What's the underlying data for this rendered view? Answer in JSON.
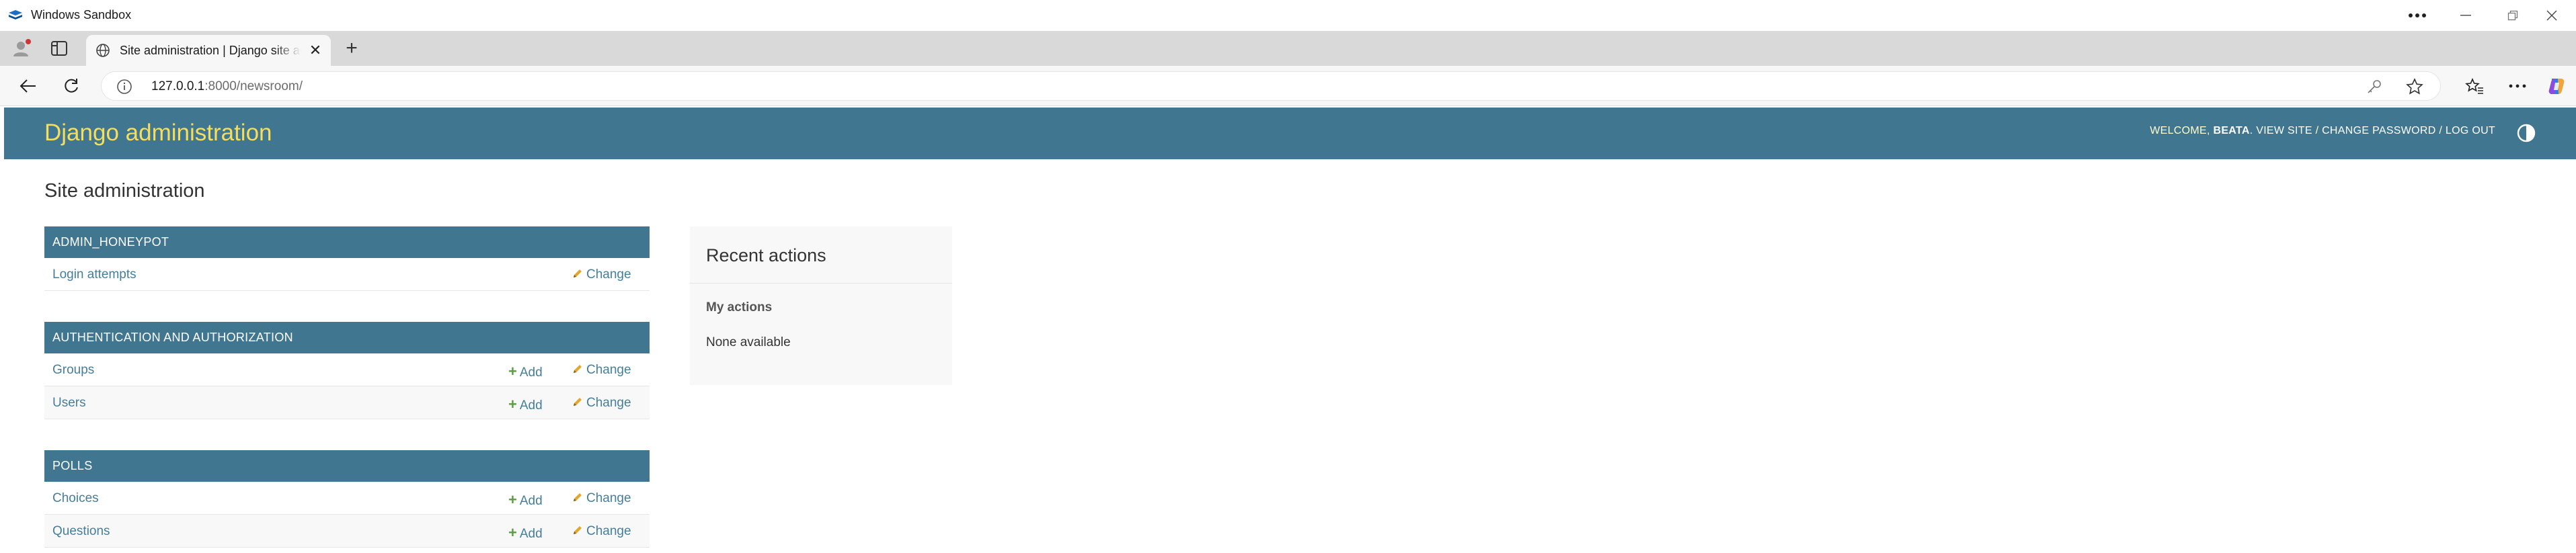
{
  "window": {
    "title": "Windows Sandbox",
    "more_icon": "more-horizontal-icon",
    "minimize_icon": "minimize-icon",
    "restore_icon": "restore-icon",
    "close_icon": "close-icon"
  },
  "browser": {
    "tab": {
      "title": "Site administration | Django site admin",
      "favicon": "globe-icon"
    },
    "address": {
      "host": "127.0.0.1",
      "rest": ":8000/newsroom/"
    },
    "colors": {
      "tabstrip": "#d9d9d9",
      "toolbar": "#f7f7f7"
    }
  },
  "django": {
    "branding": "Django administration",
    "welcome": "WELCOME,",
    "user": "BEATA",
    "view_site": "VIEW SITE",
    "sep": "/",
    "change_password": "CHANGE PASSWORD",
    "log_out": "LOG OUT",
    "colors": {
      "header": "#417690",
      "branding": "#f5dd5d",
      "link": "#447e9b",
      "add_plus": "#5a9e3f"
    }
  },
  "page_title": "Site administration",
  "modules": [
    {
      "name": "ADMIN_HONEYPOT",
      "models": [
        {
          "name": "Login attempts",
          "add": "",
          "change": "Change"
        }
      ]
    },
    {
      "name": "AUTHENTICATION AND AUTHORIZATION",
      "models": [
        {
          "name": "Groups",
          "add": "Add",
          "change": "Change"
        },
        {
          "name": "Users",
          "add": "Add",
          "change": "Change"
        }
      ]
    },
    {
      "name": "POLLS",
      "models": [
        {
          "name": "Choices",
          "add": "Add",
          "change": "Change"
        },
        {
          "name": "Questions",
          "add": "Add",
          "change": "Change"
        }
      ]
    }
  ],
  "recent_actions": {
    "title": "Recent actions",
    "subtitle": "My actions",
    "empty": "None available"
  }
}
